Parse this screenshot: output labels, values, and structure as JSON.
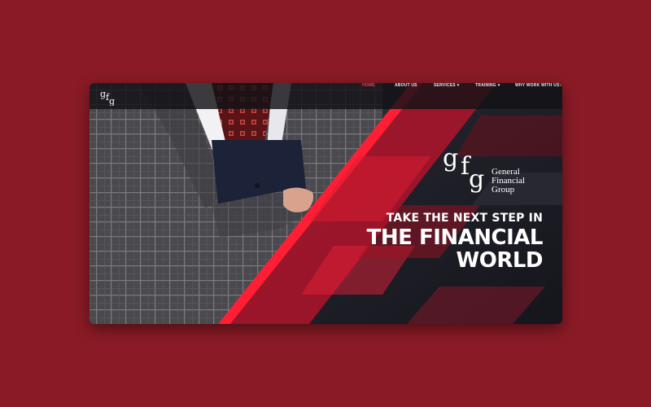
{
  "nav": {
    "items": [
      {
        "label": "HOME",
        "active": true,
        "dropdown": false
      },
      {
        "label": "ABOUT US",
        "active": false,
        "dropdown": false
      },
      {
        "label": "SERVICES",
        "active": false,
        "dropdown": true
      },
      {
        "label": "TRAINING",
        "active": false,
        "dropdown": true
      },
      {
        "label": "WHY WORK WITH US?",
        "active": false,
        "dropdown": false
      }
    ]
  },
  "logo": {
    "mark": "gfg"
  },
  "brand": {
    "mark": "gfg",
    "name_line1": "General",
    "name_line2": "Financial",
    "name_line3": "Group"
  },
  "hero": {
    "line1": "TAKE THE NEXT STEP IN",
    "line2": "THE FINANCIAL",
    "line3": "WORLD"
  },
  "colors": {
    "page_background": "#8a1b26",
    "accent": "#e8102b",
    "dark_panel": "#1f1f27"
  }
}
